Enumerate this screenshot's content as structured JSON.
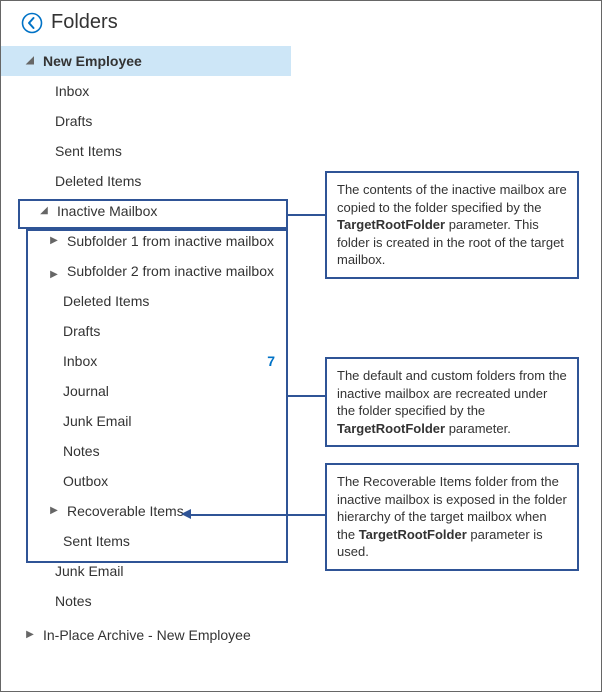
{
  "header": {
    "title": "Folders"
  },
  "tree": {
    "root": "New Employee",
    "rootChildren": [
      "Inbox",
      "Drafts",
      "Sent Items",
      "Deleted Items"
    ],
    "inactive": {
      "name": "Inactive Mailbox",
      "sub1": "Subfolder 1 from inactive mailbox",
      "sub2": "Subfolder 2 from inactive mailbox",
      "folders": [
        "Deleted Items",
        "Drafts",
        "Inbox",
        "Journal",
        "Junk Email",
        "Notes",
        "Outbox",
        "Recoverable Items",
        "Sent Items"
      ],
      "inboxCount": "7"
    },
    "afterInactive": [
      "Junk Email",
      "Notes"
    ],
    "archive": "In-Place Archive - New Employee"
  },
  "callouts": {
    "c1a": "The contents of the inactive mailbox are copied to the folder specified by the ",
    "c1b": "TargetRootFolder",
    "c1c": " parameter. This folder is created in the root of the target mailbox.",
    "c2a": "The default and custom folders from the inactive mailbox are recreated under the folder specified by the ",
    "c2b": "TargetRootFolder",
    "c2c": " parameter.",
    "c3a": "The Recoverable Items folder from the inactive mailbox is exposed in the folder hierarchy of the target mailbox when the ",
    "c3b": "TargetRootFolder",
    "c3c": " parameter is used."
  }
}
